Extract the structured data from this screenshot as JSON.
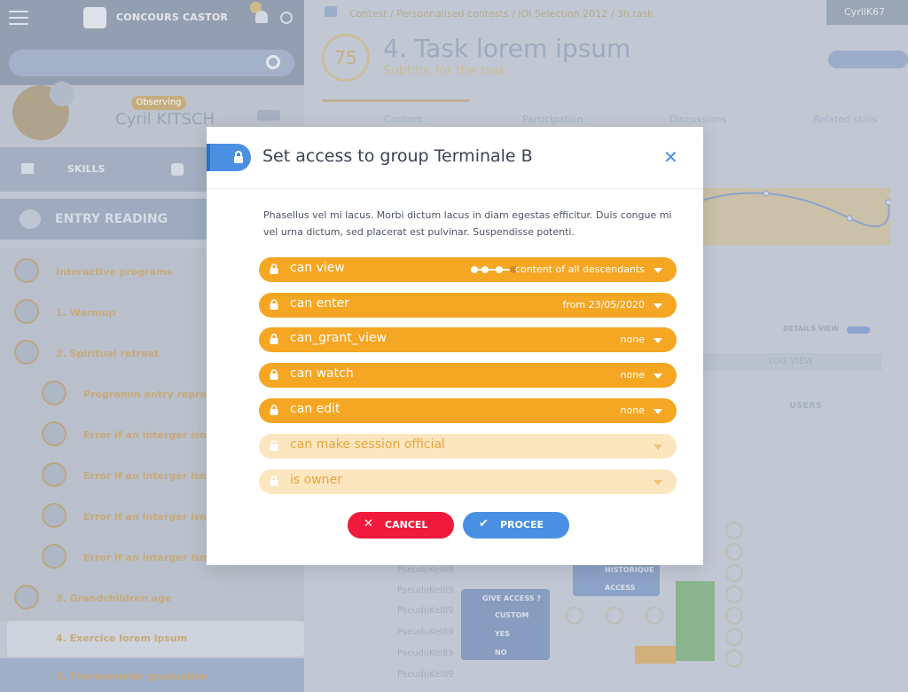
{
  "app": {
    "brand": "CONCOURS CASTOR",
    "user_pill": "CyrilK67",
    "profile_status": "Observing",
    "profile_name": "Cyril KITSCH",
    "nav_skills": "SKILLS",
    "entry_title": "ENTRY READING"
  },
  "tree": {
    "items": [
      "Interactive programs",
      "1. Warmup",
      "2. Spiritual retreat",
      "Programm entry representation",
      "Error if an interger isn't given",
      "Error if an interger isn't given",
      "Error if an interger isn't given",
      "Error if an interger isn't given",
      "3. Grandchildren age",
      "4. Exercice lorem ipsum",
      "5. Thermometer graduation"
    ]
  },
  "task": {
    "breadcrumb": "Contest / Personnalised contests / IOI Selection 2012 /  3h task",
    "score": "75",
    "title": "4. Task lorem ipsum",
    "subtitle": "Subtitle for the task",
    "tabs": [
      "Content",
      "Participation",
      "Discussions",
      "Related skills"
    ],
    "details_view": "DETAILS VIEW",
    "log_view": "LOG VIEW",
    "users_label": "USERS",
    "pseudonyms": [
      "PseudoKel89",
      "PseudoKel89",
      "PseudoKel89",
      "PseudoKel89",
      "PseudoKel89",
      "PseudoKel89"
    ],
    "history_label": "HISTORIQUE",
    "access_label": "ACCESS",
    "give_access": "GIVE ACCESS ?",
    "give_custom": "CUSTOM",
    "give_yes": "YES",
    "give_no": "NO"
  },
  "modal": {
    "title": "Set access to group Terminale B",
    "description": "Phasellus vel mi lacus. Morbi dictum lacus in diam egestas efficitur. Duis congue mi vel urna dictum, sed placerat est pulvinar. Suspendisse potenti.",
    "permissions": [
      {
        "label": "can view",
        "value": "content of all descendants",
        "level": 0.5,
        "enabled": true
      },
      {
        "label": "can enter",
        "value": "from 23/05/2020",
        "enabled": true
      },
      {
        "label": "can_grant_view",
        "value": "none",
        "enabled": true
      },
      {
        "label": "can watch",
        "value": "none",
        "enabled": true
      },
      {
        "label": "can edit",
        "value": "none",
        "enabled": true
      },
      {
        "label": "can make session official",
        "value": "",
        "enabled": false
      },
      {
        "label": "is owner",
        "value": "",
        "enabled": false
      }
    ],
    "cancel_label": "CANCEL",
    "proceed_label": "PROCEE"
  },
  "colors": {
    "accent_blue": "#4a90e2",
    "permission_orange": "#f5a623",
    "permission_disabled": "#fce6c0",
    "cancel_red": "#f01b3c"
  }
}
